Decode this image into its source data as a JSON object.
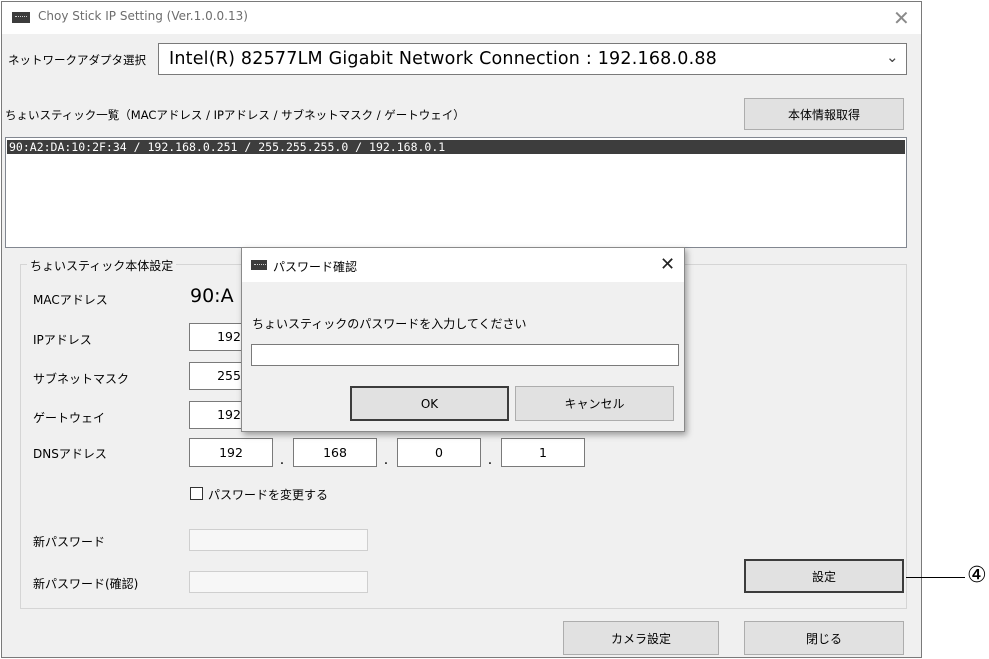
{
  "window": {
    "title": "Choy Stick IP Setting (Ver.1.0.0.13)",
    "icon": "app-window-icon",
    "close_glyph": "✕"
  },
  "adapter": {
    "label": "ネットワークアダプタ選択",
    "selected": "Intel(R) 82577LM Gigabit Network Connection : 192.168.0.88",
    "dropdown_glyph": "⌄"
  },
  "list": {
    "label": "ちょいスティック一覧（MACアドレス / IPアドレス / サブネットマスク / ゲートウェイ）",
    "get_info_button": "本体情報取得",
    "items": [
      "90:A2:DA:10:2F:34 / 192.168.0.251 / 255.255.255.0 / 192.168.0.1"
    ]
  },
  "settings": {
    "group_label": "ちょいスティック本体設定",
    "mac_label": "MACアドレス",
    "mac_value": "90:A",
    "ip_label": "IPアドレス",
    "ip_partial": "192",
    "subnet_label": "サブネットマスク",
    "subnet_partial": "255",
    "gateway_label": "ゲートウェイ",
    "gateway_partial": "192",
    "dns_label": "DNSアドレス",
    "dns": [
      "192",
      "168",
      "0",
      "1"
    ],
    "dot": ".",
    "change_password_label": "パスワードを変更する",
    "new_password_label": "新パスワード",
    "new_password_confirm_label": "新パスワード(確認)",
    "set_button": "設定"
  },
  "footer": {
    "camera_button": "カメラ設定",
    "close_button": "閉じる"
  },
  "dialog": {
    "title": "パスワード確認",
    "message": "ちょいスティックのパスワードを入力してください",
    "password_value": "",
    "ok": "OK",
    "cancel": "キャンセル",
    "close_glyph": "✕"
  },
  "annotation": {
    "callout": "④"
  }
}
